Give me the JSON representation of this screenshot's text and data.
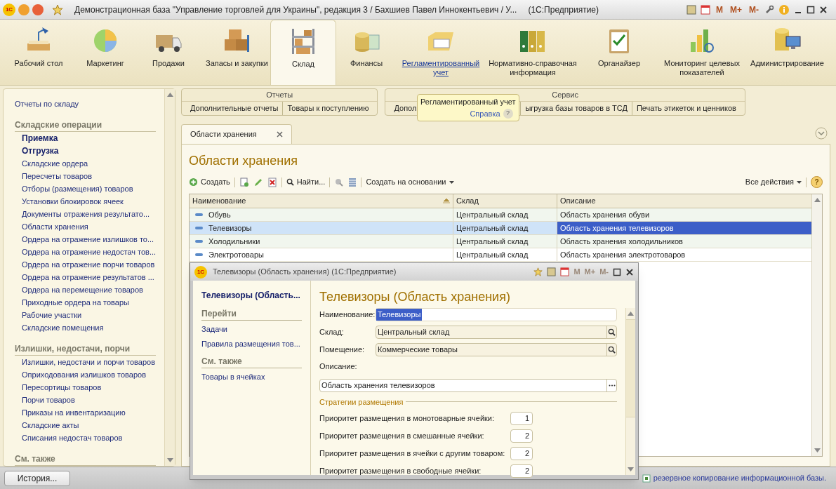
{
  "window": {
    "logo": "1С",
    "title": "Демонстрационная база \"Управление торговлей для Украины\", редакция 3 / Бахшиев Павел Иннокентьевич / У...",
    "app": "(1С:Предприятие)",
    "memory_buttons": [
      "M",
      "M+",
      "M-"
    ]
  },
  "sections": [
    {
      "label": "Рабочий стол",
      "selected": false,
      "hovered": false
    },
    {
      "label": "Маркетинг",
      "selected": false,
      "hovered": false
    },
    {
      "label": "Продажи",
      "selected": false,
      "hovered": false
    },
    {
      "label": "Запасы и закупки",
      "selected": false,
      "hovered": false
    },
    {
      "label": "Склад",
      "selected": true,
      "hovered": false
    },
    {
      "label": "Финансы",
      "selected": false,
      "hovered": false
    },
    {
      "label": "Регламентированный учет",
      "selected": false,
      "hovered": true
    },
    {
      "label": "Нормативно-справочная информация",
      "selected": false,
      "hovered": false
    },
    {
      "label": "Органайзер",
      "selected": false,
      "hovered": false
    },
    {
      "label": "Мониторинг целевых показателей",
      "selected": false,
      "hovered": false
    },
    {
      "label": "Администрирование",
      "selected": false,
      "hovered": false
    }
  ],
  "command_groups": [
    {
      "title": "Отчеты",
      "items": [
        "Дополнительные отчеты",
        "Товары к поступлению"
      ]
    },
    {
      "title": "Сервис",
      "items": [
        "Допол",
        "ыгрузка базы товаров в ТСД",
        "Печать этикеток и ценников"
      ]
    }
  ],
  "tooltip": {
    "title": "Регламентированный учет",
    "link": "Справка",
    "help": "?"
  },
  "sidebar": {
    "top_link": "Отчеты по складу",
    "groups": [
      {
        "title": "Складские операции",
        "items": [
          {
            "label": "Приемка",
            "bold": true
          },
          {
            "label": "Отгрузка",
            "bold": true
          },
          {
            "label": "Складские ордера",
            "bold": false
          },
          {
            "label": "Пересчеты товаров",
            "bold": false
          },
          {
            "label": "Отборы (размещения) товаров",
            "bold": false
          },
          {
            "label": "Установки блокировок ячеек",
            "bold": false
          },
          {
            "label": "Документы отражения результато...",
            "bold": false
          },
          {
            "label": "Области хранения",
            "bold": false
          },
          {
            "label": "Ордера на отражение излишков то...",
            "bold": false
          },
          {
            "label": "Ордера на отражение недостач тов...",
            "bold": false
          },
          {
            "label": "Ордера на отражение порчи товаров",
            "bold": false
          },
          {
            "label": "Ордера на отражение результатов ...",
            "bold": false
          },
          {
            "label": "Ордера на перемещение товаров",
            "bold": false
          },
          {
            "label": "Приходные ордера на товары",
            "bold": false
          },
          {
            "label": "Рабочие участки",
            "bold": false
          },
          {
            "label": "Складские помещения",
            "bold": false
          }
        ]
      },
      {
        "title": "Излишки, недостачи, порчи",
        "items": [
          {
            "label": "Излишки, недостачи и порчи товаров",
            "bold": false
          },
          {
            "label": "Оприходования излишков товаров",
            "bold": false
          },
          {
            "label": "Пересортицы товаров",
            "bold": false
          },
          {
            "label": "Порчи товаров",
            "bold": false
          },
          {
            "label": "Приказы на инвентаризацию",
            "bold": false
          },
          {
            "label": "Складские акты",
            "bold": false
          },
          {
            "label": "Списания недостач товаров",
            "bold": false
          }
        ]
      },
      {
        "title": "См. также"
      }
    ]
  },
  "history_button": "История...",
  "tab": {
    "label": "Области хранения"
  },
  "list": {
    "title": "Области хранения",
    "toolbar": {
      "create": "Создать",
      "find": "Найти...",
      "create_based": "Создать на основании",
      "all_actions": "Все действия",
      "help": "?"
    },
    "columns": [
      "Наименование",
      "Склад",
      "Описание"
    ],
    "rows": [
      {
        "cells": [
          "Обувь",
          "Центральный склад",
          "Область хранения обуви"
        ],
        "selected": false
      },
      {
        "cells": [
          "Телевизоры",
          "Центральный склад",
          "Область хранения телевизоров"
        ],
        "selected": true
      },
      {
        "cells": [
          "Холодильники",
          "Центральный склад",
          "Область хранения холодильников"
        ],
        "selected": false
      },
      {
        "cells": [
          "Электротовары",
          "Центральный склад",
          "Область хранения электротоваров"
        ],
        "selected": false
      }
    ]
  },
  "dialog": {
    "logo": "1С",
    "title": "Телевизоры (Область хранения)  (1С:Предприятие)",
    "memory_buttons": [
      {
        "label": "M",
        "disabled": true
      },
      {
        "label": "M+",
        "disabled": true
      },
      {
        "label": "M-",
        "disabled": true
      }
    ],
    "nav": {
      "title": "Телевизоры (Область...",
      "groups": [
        {
          "title": "Перейти",
          "items": [
            "Задачи",
            "Правила размещения тов..."
          ]
        },
        {
          "title": "См. также",
          "items": [
            "Товары в ячейках"
          ]
        }
      ]
    },
    "heading": "Телевизоры (Область хранения)",
    "fields": [
      {
        "kind": "text",
        "label": "Наименование:",
        "value": "Телевизоры",
        "value_selected": true
      },
      {
        "kind": "lookup",
        "label": "Склад:",
        "value": "Центральный склад",
        "value_selected": false
      },
      {
        "kind": "lookup",
        "label": "Помещение:",
        "value": "Коммерческие товары",
        "value_selected": false
      },
      {
        "kind": "memo",
        "label": "Описание:",
        "value": "Область хранения телевизоров",
        "value_selected": false
      }
    ],
    "section": "Стратегии размещения",
    "priorities": [
      {
        "label": "Приоритет размещения в монотоварные ячейки:",
        "value": "1"
      },
      {
        "label": "Приоритет размещения в смешанные ячейки:",
        "value": "2"
      },
      {
        "label": "Приоритет размещения в ячейки с другим товаром:",
        "value": "2"
      },
      {
        "label": "Приоритет размещения в свободные ячейки:",
        "value": "2"
      }
    ]
  },
  "status_bar": {
    "message": "резервное копирование информационной базы."
  }
}
